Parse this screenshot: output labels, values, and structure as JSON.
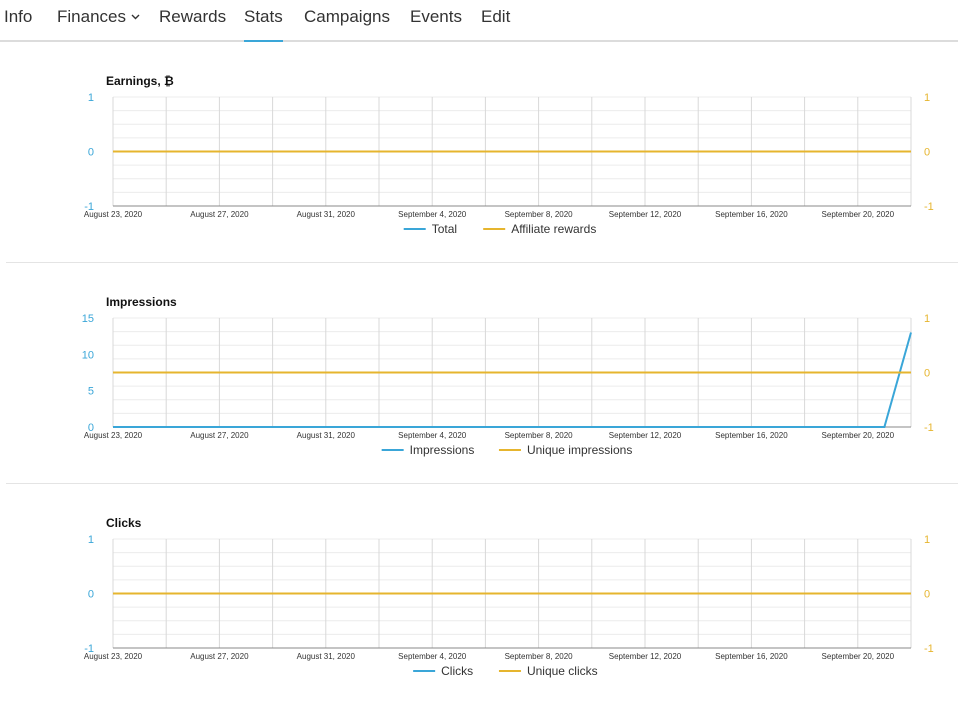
{
  "colors": {
    "primary": "#3aa6d8",
    "secondary": "#e6b52e"
  },
  "tabs": [
    {
      "label": "Info",
      "active": false
    },
    {
      "label": "Finances",
      "active": false,
      "has_dropdown": true
    },
    {
      "label": "Rewards",
      "active": false
    },
    {
      "label": "Stats",
      "active": true
    },
    {
      "label": "Campaigns",
      "active": false
    },
    {
      "label": "Events",
      "active": false
    },
    {
      "label": "Edit",
      "active": false
    }
  ],
  "chart_data": [
    {
      "type": "line",
      "title": "Earnings, ₿",
      "x_tick_labels": [
        "August 23, 2020",
        "August 27, 2020",
        "August 31, 2020",
        "September 4, 2020",
        "September 8, 2020",
        "September 12, 2020",
        "September 16, 2020",
        "September 20, 2020"
      ],
      "x_range": [
        "August 23, 2020",
        "September 22, 2020"
      ],
      "left_axis": {
        "ticks": [
          "1",
          "0",
          "-1"
        ],
        "range": [
          -1,
          1
        ]
      },
      "right_axis": {
        "ticks": [
          "1",
          "0",
          "-1"
        ],
        "range": [
          -1,
          1
        ]
      },
      "series": [
        {
          "name": "Total",
          "axis": "left",
          "points": [
            [
              "August 23, 2020",
              0
            ],
            [
              "September 22, 2020",
              0
            ]
          ]
        },
        {
          "name": "Affiliate rewards",
          "axis": "right",
          "points": [
            [
              "August 23, 2020",
              0
            ],
            [
              "September 22, 2020",
              0
            ]
          ]
        }
      ],
      "grid": true,
      "legend": "bottom"
    },
    {
      "type": "line",
      "title": "Impressions",
      "x_tick_labels": [
        "August 23, 2020",
        "August 27, 2020",
        "August 31, 2020",
        "September 4, 2020",
        "September 8, 2020",
        "September 12, 2020",
        "September 16, 2020",
        "September 20, 2020"
      ],
      "x_range": [
        "August 23, 2020",
        "September 22, 2020"
      ],
      "left_axis": {
        "ticks": [
          "15",
          "10",
          "5",
          "0"
        ],
        "range": [
          0,
          15
        ]
      },
      "right_axis": {
        "ticks": [
          "1",
          "0",
          "-1"
        ],
        "range": [
          -1,
          1
        ]
      },
      "series": [
        {
          "name": "Impressions",
          "axis": "left",
          "points": [
            [
              "August 23, 2020",
              0
            ],
            [
              "September 21, 2020",
              0
            ],
            [
              "September 22, 2020",
              13
            ]
          ]
        },
        {
          "name": "Unique impressions",
          "axis": "right",
          "points": [
            [
              "August 23, 2020",
              0
            ],
            [
              "September 22, 2020",
              0
            ]
          ]
        }
      ],
      "grid": true,
      "legend": "bottom"
    },
    {
      "type": "line",
      "title": "Clicks",
      "x_tick_labels": [
        "August 23, 2020",
        "August 27, 2020",
        "August 31, 2020",
        "September 4, 2020",
        "September 8, 2020",
        "September 12, 2020",
        "September 16, 2020",
        "September 20, 2020"
      ],
      "x_range": [
        "August 23, 2020",
        "September 22, 2020"
      ],
      "left_axis": {
        "ticks": [
          "1",
          "0",
          "-1"
        ],
        "range": [
          -1,
          1
        ]
      },
      "right_axis": {
        "ticks": [
          "1",
          "0",
          "-1"
        ],
        "range": [
          -1,
          1
        ]
      },
      "series": [
        {
          "name": "Clicks",
          "axis": "left",
          "points": [
            [
              "August 23, 2020",
              0
            ],
            [
              "September 22, 2020",
              0
            ]
          ]
        },
        {
          "name": "Unique clicks",
          "axis": "right",
          "points": [
            [
              "August 23, 2020",
              0
            ],
            [
              "September 22, 2020",
              0
            ]
          ]
        }
      ],
      "grid": true,
      "legend": "bottom"
    }
  ]
}
